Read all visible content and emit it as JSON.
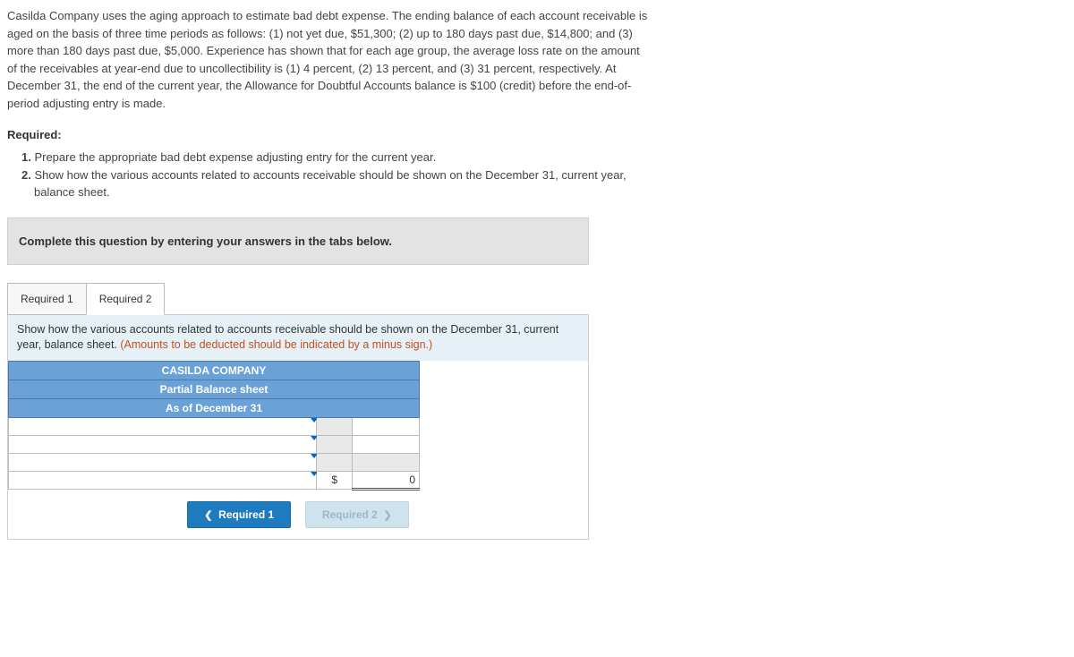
{
  "problem": "Casilda Company uses the aging approach to estimate bad debt expense. The ending balance of each account receivable is aged on the basis of three time periods as follows: (1) not yet due, $51,300; (2) up to 180 days past due, $14,800; and (3) more than 180 days past due, $5,000. Experience has shown that for each age group, the average loss rate on the amount of the receivables at year-end due to uncollectibility is (1) 4 percent, (2) 13 percent, and (3) 31 percent, respectively. At December 31, the end of the current year, the Allowance for Doubtful Accounts balance is $100 (credit) before the end-of-period adjusting entry is made.",
  "required_label": "Required:",
  "required_items": [
    {
      "num": "1.",
      "text": " Prepare the appropriate bad debt expense adjusting entry for the current year."
    },
    {
      "num": "2.",
      "text": " Show how the various accounts related to accounts receivable should be shown on the December 31, current year, balance sheet."
    }
  ],
  "complete_banner": "Complete this question by entering your answers in the tabs below.",
  "tabs": {
    "tab1": "Required 1",
    "tab2": "Required 2"
  },
  "panel": {
    "instruction_main": "Show how the various accounts related to accounts receivable should be shown on the December 31, current year, balance sheet. ",
    "instruction_note": "(Amounts to be deducted should be indicated by a minus sign.)"
  },
  "table": {
    "header1": "CASILDA COMPANY",
    "header2": "Partial Balance sheet",
    "header3": "As of December 31",
    "currency": "$",
    "total_value": "0"
  },
  "nav": {
    "prev": "Required 1",
    "next": "Required 2"
  }
}
